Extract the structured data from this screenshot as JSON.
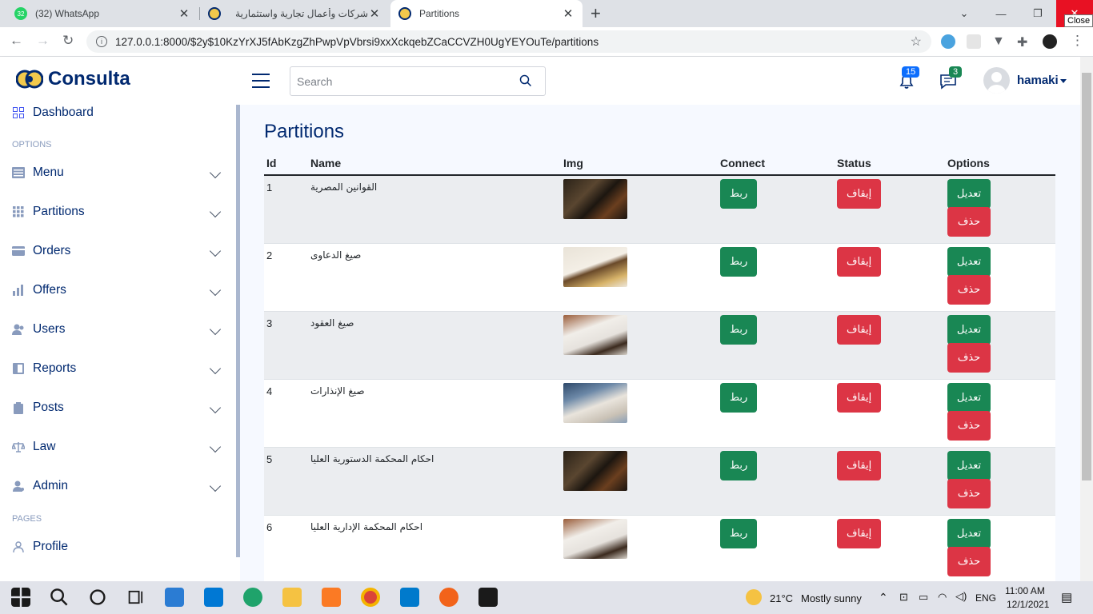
{
  "browser": {
    "tabs": [
      {
        "title": "(32) WhatsApp",
        "favicon_text": "32",
        "active": false
      },
      {
        "title": "شركات وأعمال تجارية واستثمارية",
        "active": false
      },
      {
        "title": "Partitions",
        "active": true
      }
    ],
    "close_tooltip": "Close",
    "url": "127.0.0.1:8000/$2y$10KzYrXJ5fAbKzgZhPwpVpVbrsi9xxXckqebZCaCCVZH0UgYEYOuTe/partitions"
  },
  "header": {
    "logo_text": "Consulta",
    "search_placeholder": "Search",
    "notifications_count": "15",
    "messages_count": "3",
    "username": "hamaki"
  },
  "sidebar": {
    "dashboard": "Dashboard",
    "options_heading": "OPTIONS",
    "items": [
      {
        "label": "Menu",
        "icon": "menu-icon"
      },
      {
        "label": "Partitions",
        "icon": "grid-icon"
      },
      {
        "label": "Orders",
        "icon": "card-icon"
      },
      {
        "label": "Offers",
        "icon": "bar-chart-icon"
      },
      {
        "label": "Users",
        "icon": "users-icon"
      },
      {
        "label": "Reports",
        "icon": "reports-icon"
      },
      {
        "label": "Posts",
        "icon": "clipboard-icon"
      },
      {
        "label": "Law",
        "icon": "scales-icon"
      },
      {
        "label": "Admin",
        "icon": "admin-icon"
      }
    ],
    "pages_heading": "PAGES",
    "profile": "Profile"
  },
  "main": {
    "title": "Partitions",
    "columns": [
      "Id",
      "Name",
      "Img",
      "Connect",
      "Status",
      "Options"
    ],
    "connect_label": "ربط",
    "status_label": "إيقاف",
    "edit_label": "تعديل",
    "delete_label": "حذف",
    "rows": [
      {
        "id": "1",
        "name": "القوانين المصرية",
        "img": "law-books-gavel"
      },
      {
        "id": "2",
        "name": "صيغ الدعاوى",
        "img": "lawsuit-paper-gavel"
      },
      {
        "id": "3",
        "name": "صيغ العقود",
        "img": "contract-gavel"
      },
      {
        "id": "4",
        "name": "صيغ الإنذارات",
        "img": "signing-document"
      },
      {
        "id": "5",
        "name": "احكام المحكمة الدستورية العليا",
        "img": "law-books-gavel"
      },
      {
        "id": "6",
        "name": "احكام المحكمة الإدارية العليا",
        "img": "contract-gavel"
      }
    ]
  },
  "taskbar": {
    "temperature": "21°C",
    "weather": "Mostly sunny",
    "language": "ENG",
    "time": "11:00 AM",
    "date": "12/1/2021"
  },
  "colors": {
    "brand": "#012970",
    "connect": "#198754",
    "stop": "#dc3545"
  }
}
